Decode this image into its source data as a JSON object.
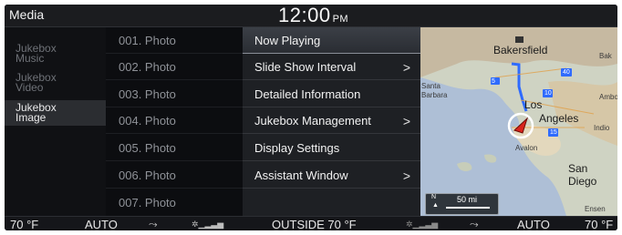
{
  "topbar": {
    "app_title": "Media",
    "clock_time": "12:00",
    "clock_ampm": "PM"
  },
  "sidebar": {
    "items": [
      {
        "label_line1": "Jukebox",
        "label_line2": "Music",
        "active": false
      },
      {
        "label_line1": "Jukebox",
        "label_line2": "Video",
        "active": false
      },
      {
        "label_line1": "Jukebox",
        "label_line2": "Image",
        "active": true
      }
    ]
  },
  "photos": [
    "001. Photo",
    "002. Photo",
    "003. Photo",
    "004. Photo",
    "005. Photo",
    "006. Photo",
    "007. Photo"
  ],
  "menu": {
    "items": [
      {
        "label": "Now Playing",
        "has_submenu": false,
        "active": true
      },
      {
        "label": "Slide Show Interval",
        "has_submenu": true,
        "active": false
      },
      {
        "label": "Detailed Information",
        "has_submenu": false,
        "active": false
      },
      {
        "label": "Jukebox Management",
        "has_submenu": true,
        "active": false
      },
      {
        "label": "Display Settings",
        "has_submenu": false,
        "active": false
      },
      {
        "label": "Assistant Window",
        "has_submenu": true,
        "active": false
      }
    ],
    "chevron": ">"
  },
  "map": {
    "labels": {
      "bakersfield": "Bakersfield",
      "bak": "Bak",
      "santa": "Santa",
      "barbara": "Barbara",
      "los": "Los",
      "angeles": "Angeles",
      "amboy": "Ambo",
      "indio": "Indio",
      "avalon": "Avalon",
      "san": "San",
      "diego": "Diego",
      "ensen": "Ensen"
    },
    "highway_shields": [
      "5",
      "40",
      "10",
      "15"
    ],
    "compass": "N",
    "scale": "50 mi",
    "colors": {
      "route": "#2f6bff",
      "marker": "#d9241b",
      "water": "#aebfd6"
    }
  },
  "climate": {
    "left_temp": "70 °F",
    "left_mode": "AUTO",
    "outside": "OUTSIDE  70 °F",
    "right_mode": "AUTO",
    "right_temp": "70 °F"
  }
}
